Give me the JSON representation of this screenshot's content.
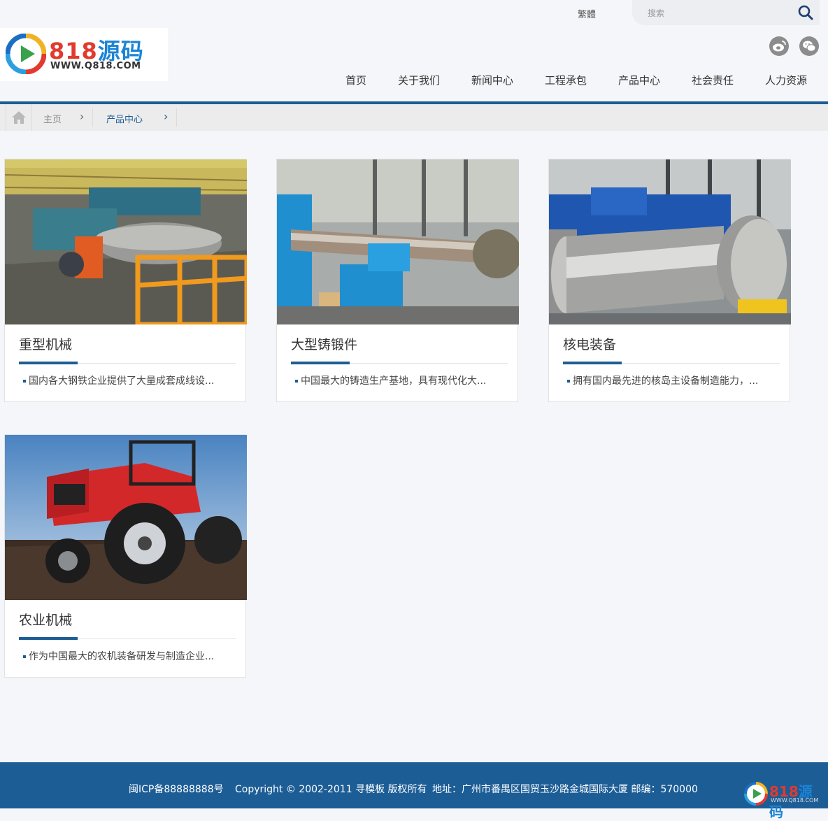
{
  "header": {
    "lang_toggle": "繁體",
    "search_placeholder": "搜索",
    "logo_number": "818",
    "logo_text": "源码",
    "logo_url": "WWW.Q818.COM",
    "social": [
      "weibo-icon",
      "wechat-icon"
    ],
    "nav": [
      "首页",
      "关于我们",
      "新闻中心",
      "工程承包",
      "产品中心",
      "社会责任",
      "人力资源"
    ]
  },
  "breadcrumb": {
    "home": "主页",
    "current": "产品中心"
  },
  "products": [
    {
      "title": "重型机械",
      "desc": "国内各大钢铁企业提供了大量成套成线设...",
      "image": "steel-mill-line"
    },
    {
      "title": "大型铸锻件",
      "desc": "中国最大的铸造生产基地，具有现代化大...",
      "image": "large-forging-lathe"
    },
    {
      "title": "核电装备",
      "desc": "拥有国内最先进的核岛主设备制造能力，...",
      "image": "nuclear-shaft"
    },
    {
      "title": "农业机械",
      "desc": "作为中国最大的农机装备研发与制造企业...",
      "image": "red-tractor"
    }
  ],
  "footer": {
    "icp": "闽ICP备88888888号",
    "copyright": "Copyright © 2002-2011 寻模板 版权所有",
    "address": "地址：广州市番禺区国贸玉沙路金城国际大厦 邮编：570000",
    "logo_number": "818",
    "logo_text": "源码",
    "logo_url": "WWW.Q818.COM"
  },
  "colors": {
    "primary": "#1d5d94",
    "brand_red": "#e23a2f",
    "brand_blue": "#1a84d6",
    "page_bg": "#f4f6f9"
  }
}
